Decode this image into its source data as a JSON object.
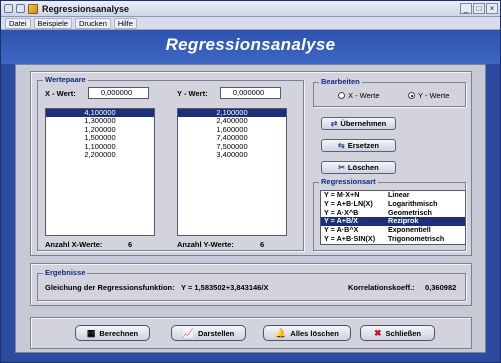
{
  "window": {
    "title": "Regressionsanalyse",
    "controls": {
      "minimize": "_",
      "maximize": "□",
      "close": "×"
    }
  },
  "menu": [
    "Datei",
    "Beispiele",
    "Drucken",
    "Hilfe"
  ],
  "header": {
    "title": "Regressionsanalyse"
  },
  "wertepaare": {
    "caption": "Wertepaare",
    "x_label": "X - Wert:",
    "x_value": "0,000000",
    "y_label": "Y - Wert:",
    "y_value": "0,000000",
    "x_list": [
      "4,100000",
      "1,300000",
      "1,200000",
      "1,500000",
      "1,100000",
      "2,200000"
    ],
    "y_list": [
      "2,100000",
      "2,400000",
      "1,600000",
      "7,400000",
      "7,500000",
      "3,400000"
    ],
    "x_selected_index": 0,
    "y_selected_index": 0,
    "x_count_label": "Anzahl X-Werte:",
    "x_count": "6",
    "y_count_label": "Anzahl Y-Werte:",
    "y_count": "6"
  },
  "bearbeiten": {
    "caption": "Bearbeiten",
    "options": [
      "X - Werte",
      "Y - Werte"
    ],
    "selected": 1,
    "buttons": {
      "uebernehmen": "Übernehmen",
      "ersetzen": "Ersetzen",
      "loeschen": "Löschen"
    }
  },
  "regressionsart": {
    "caption": "Regressionsart",
    "selected_index": 3,
    "items": [
      {
        "formula": "Y = M·X+N",
        "name": "Linear"
      },
      {
        "formula": "Y = A+B·LN(X)",
        "name": "Logarithmisch"
      },
      {
        "formula": "Y = A·X^B",
        "name": "Geometrisch"
      },
      {
        "formula": "Y = A+B/X",
        "name": "Reziprok"
      },
      {
        "formula": "Y = A·B^X",
        "name": "Exponentiell"
      },
      {
        "formula": "Y = A+B·SIN(X)",
        "name": "Trigonometrisch"
      }
    ]
  },
  "ergebnisse": {
    "caption": "Ergebnisse",
    "function_label": "Gleichung der Regressionsfunktion:",
    "function_value": "Y = 1,583502+3,843146/X",
    "korrelation_label": "Korrelationskoeff.:",
    "korrelation_value": "0,360982"
  },
  "bottom_buttons": {
    "berechnen": "Berechnen",
    "darstellen": "Darstellen",
    "alles_loeschen": "Alles löschen",
    "schliessen": "Schließen"
  },
  "colors": {
    "frame": "#2a4b9e",
    "header": "#3d67c4",
    "selection": "#1d2f76",
    "panel": "#d2d3dc"
  }
}
